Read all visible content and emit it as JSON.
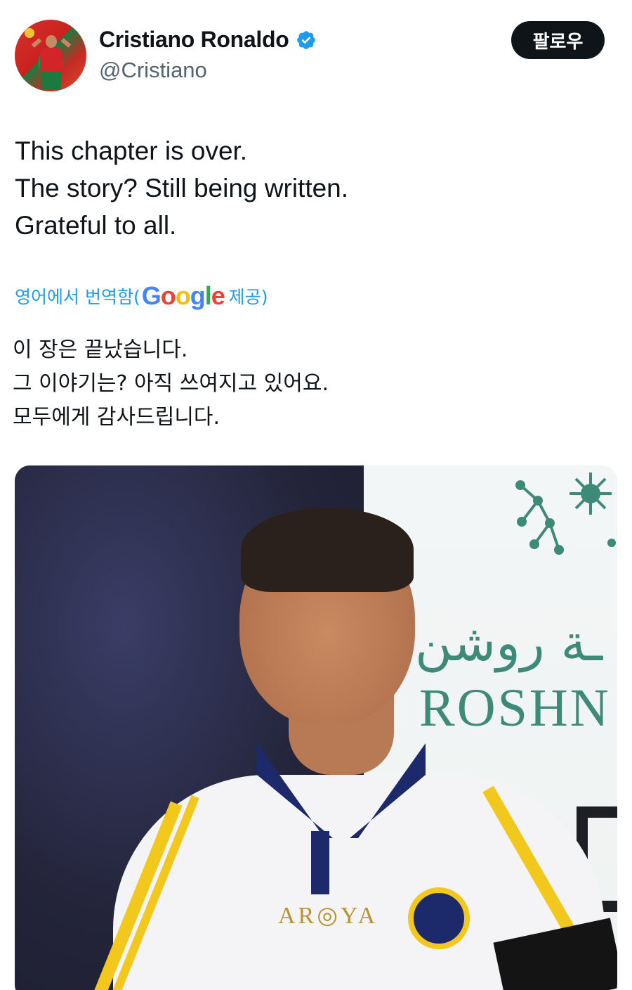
{
  "author": {
    "display_name": "Cristiano Ronaldo",
    "handle": "@Cristiano",
    "verified": true
  },
  "actions": {
    "follow_label": "팔로우"
  },
  "tweet": {
    "lines": [
      "This chapter is over.",
      "The story? Still being written.",
      "Grateful to all."
    ]
  },
  "translation": {
    "prefix": "영어에서 번역함(",
    "provider_letters": [
      "G",
      "o",
      "o",
      "g",
      "l",
      "e"
    ],
    "suffix": " 제공)",
    "lines": [
      "이 장은 끝났습니다.",
      "그 이야기는? 아직 쓰여지고 있어요.",
      "모두에게 감사드립니다."
    ]
  },
  "photo": {
    "board_arabic": "ـة روشن",
    "board_text": "ROSHN",
    "sponsor_text": "AR◎YA"
  },
  "colors": {
    "accent": "#1d9bf0",
    "verified": "#1d9bf0",
    "text_primary": "#0f1419",
    "text_secondary": "#536471"
  },
  "icons": {
    "verified": "verified-badge-icon"
  }
}
